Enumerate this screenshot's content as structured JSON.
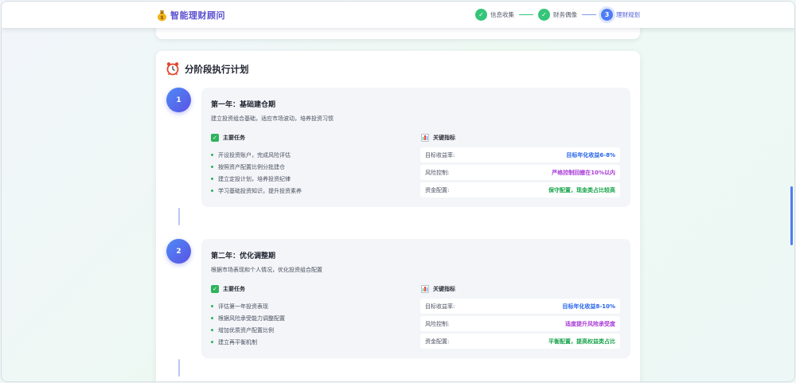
{
  "header": {
    "brand_icon": "money-bag-icon",
    "title": "智能理财顾问",
    "steps": [
      {
        "label": "信息收集",
        "state": "done",
        "mark": "✓"
      },
      {
        "label": "财务偶像",
        "state": "done",
        "mark": "✓"
      },
      {
        "label": "理财规划",
        "state": "active",
        "mark": "3"
      }
    ]
  },
  "plan": {
    "icon": "alarm-clock-icon",
    "title": "分阶段执行计划",
    "phases": [
      {
        "number": "1",
        "title": "第一年：基础建仓期",
        "description": "建立投资组合基础，适应市场波动，培养投资习惯",
        "tasks_heading": "主要任务",
        "tasks": [
          "开设投资账户，完成风险评估",
          "按照资产配置比例分批建仓",
          "建立定投计划，培养投资纪律",
          "学习基础投资知识，提升投资素养"
        ],
        "metrics_heading": "关键指标",
        "metrics": [
          {
            "label": "目标收益率:",
            "value": "目标年化收益6-8%",
            "color": "#2563eb"
          },
          {
            "label": "风险控制:",
            "value": "严格控制回撤在10%以内",
            "color": "#a83bd6"
          },
          {
            "label": "资金配置:",
            "value": "保守配置，现金类占比较高",
            "color": "#16a34a"
          }
        ]
      },
      {
        "number": "2",
        "title": "第二年：优化调整期",
        "description": "根据市场表现和个人情况，优化投资组合配置",
        "tasks_heading": "主要任务",
        "tasks": [
          "评估第一年投资表现",
          "根据风险承受能力调整配置",
          "增加优质资产配置比例",
          "建立再平衡机制"
        ],
        "metrics_heading": "关键指标",
        "metrics": [
          {
            "label": "目标收益率:",
            "value": "目标年化收益8-10%",
            "color": "#2563eb"
          },
          {
            "label": "风险控制:",
            "value": "适度提升风险承受度",
            "color": "#a83bd6"
          },
          {
            "label": "资金配置:",
            "value": "平衡配置，提高权益类占比",
            "color": "#16a34a"
          }
        ]
      }
    ]
  }
}
